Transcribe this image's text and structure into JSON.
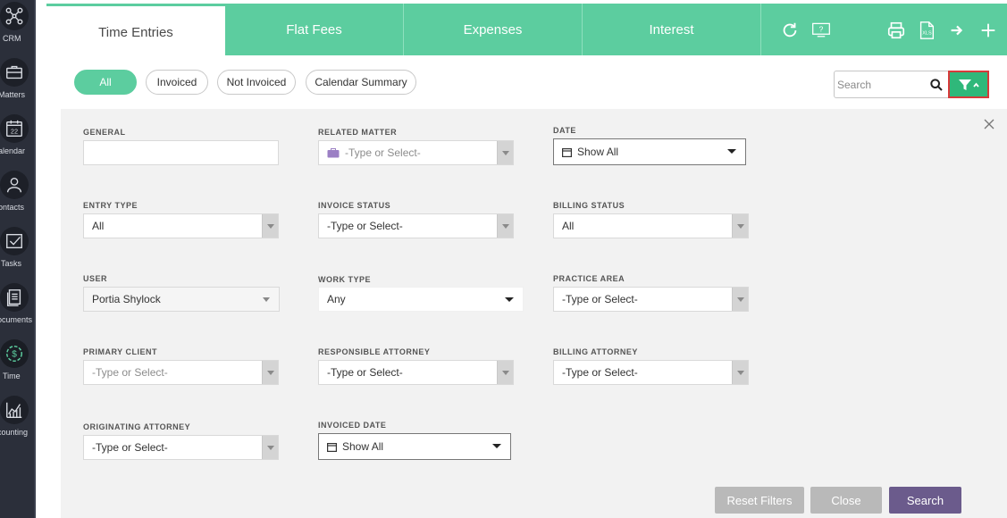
{
  "rail": {
    "items": [
      {
        "label": "CRM",
        "icon": "crm-network-icon"
      },
      {
        "label": "Matters",
        "icon": "briefcase-icon"
      },
      {
        "label": "alendar",
        "icon": "calendar-icon",
        "day": "22"
      },
      {
        "label": "ontacts",
        "icon": "contacts-icon"
      },
      {
        "label": "Tasks",
        "icon": "tasks-icon"
      },
      {
        "label": "ocuments",
        "icon": "documents-icon"
      },
      {
        "label": "Time",
        "icon": "time-money-icon"
      },
      {
        "label": "counting",
        "icon": "accounting-chart-icon"
      }
    ]
  },
  "tabs": [
    {
      "label": "Time Entries",
      "active": true
    },
    {
      "label": "Flat Fees"
    },
    {
      "label": "Expenses"
    },
    {
      "label": "Interest"
    }
  ],
  "toolbar": {
    "help_text": "?",
    "xls_text": "XLS"
  },
  "pills": [
    "All",
    "Invoiced",
    "Not Invoiced",
    "Calendar Summary"
  ],
  "search": {
    "placeholder": "Search"
  },
  "filters": {
    "general": {
      "label": "GENERAL",
      "value": ""
    },
    "related_matter": {
      "label": "RELATED MATTER",
      "placeholder": "-Type or Select-"
    },
    "date": {
      "label": "DATE",
      "value": "Show All"
    },
    "entry_type": {
      "label": "ENTRY TYPE",
      "value": "All"
    },
    "invoice_status": {
      "label": "INVOICE STATUS",
      "value": "-Type or Select-"
    },
    "billing_status": {
      "label": "BILLING STATUS",
      "value": "All"
    },
    "user": {
      "label": "USER",
      "value": "Portia Shylock"
    },
    "work_type": {
      "label": "WORK TYPE",
      "value": "Any"
    },
    "practice_area": {
      "label": "PRACTICE AREA",
      "value": "-Type or Select-"
    },
    "primary_client": {
      "label": "PRIMARY CLIENT",
      "placeholder": "-Type or Select-"
    },
    "responsible_attorney": {
      "label": "RESPONSIBLE ATTORNEY",
      "value": "-Type or Select-"
    },
    "billing_attorney": {
      "label": "BILLING ATTORNEY",
      "value": "-Type or Select-"
    },
    "originating_attorney": {
      "label": "ORIGINATING ATTORNEY",
      "value": "-Type or Select-"
    },
    "invoiced_date": {
      "label": "INVOICED DATE",
      "value": "Show All"
    }
  },
  "buttons": {
    "reset": "Reset Filters",
    "close": "Close",
    "search": "Search"
  },
  "colors": {
    "accent": "#5ccd9f",
    "filter_active": "#2fb87a",
    "highlight_border": "#d73a3a",
    "primary_button": "#6b5b8c",
    "rail": "#2b2f3a"
  }
}
